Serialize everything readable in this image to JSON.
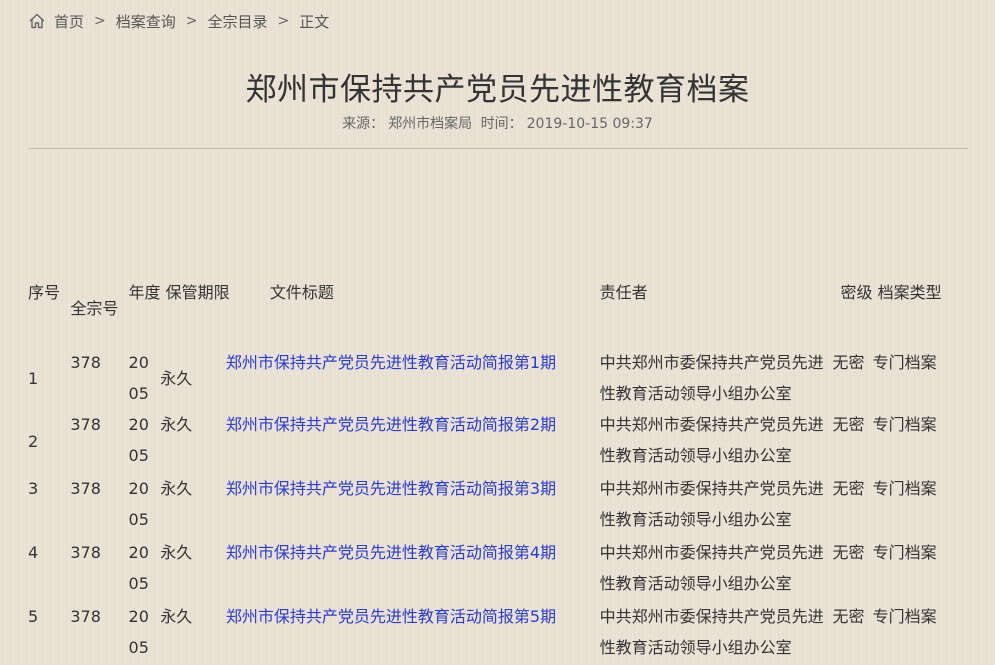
{
  "breadcrumb": {
    "home": "首页",
    "archive_query": "档案查询",
    "catalog": "全宗目录",
    "current": "正文",
    "separator": ">"
  },
  "article": {
    "title": "郑州市保持共产党员先进性教育档案",
    "source_label": "来源：",
    "source": "郑州市档案局",
    "time_label": "时间：",
    "time": "2019-10-15 09:37"
  },
  "table": {
    "headers": {
      "seq": "序号",
      "fonds": "全宗号",
      "year": "年度",
      "period": "保管期限",
      "title": "文件标题",
      "responsible": "责任者",
      "secret": "密级",
      "type": "档案类型"
    },
    "rows": [
      {
        "seq": "1",
        "fonds": "378",
        "year": "2005",
        "period": "永久",
        "title": "郑州市保持共产党员先进性教育活动简报第1期",
        "responsible": "中共郑州市委保持共产党员先进性教育活动领导小组办公室",
        "secret": "无密",
        "type": "专门档案"
      },
      {
        "seq": "2",
        "fonds": "378",
        "year": "2005",
        "period": "永久",
        "title": "郑州市保持共产党员先进性教育活动简报第2期",
        "responsible": "中共郑州市委保持共产党员先进性教育活动领导小组办公室",
        "secret": "无密",
        "type": "专门档案"
      },
      {
        "seq": "3",
        "fonds": "378",
        "year": "2005",
        "period": "永久",
        "title": "郑州市保持共产党员先进性教育活动简报第3期",
        "responsible": "中共郑州市委保持共产党员先进性教育活动领导小组办公室",
        "secret": "无密",
        "type": "专门档案"
      },
      {
        "seq": "4",
        "fonds": "378",
        "year": "2005",
        "period": "永久",
        "title": "郑州市保持共产党员先进性教育活动简报第4期",
        "responsible": "中共郑州市委保持共产党员先进性教育活动领导小组办公室",
        "secret": "无密",
        "type": "专门档案"
      },
      {
        "seq": "5",
        "fonds": "378",
        "year": "2005",
        "period": "永久",
        "title": "郑州市保持共产党员先进性教育活动简报第5期",
        "responsible": "中共郑州市委保持共产党员先进性教育活动领导小组办公室",
        "secret": "无密",
        "type": "专门档案"
      }
    ]
  },
  "colors": {
    "background": "#ece4d6",
    "link": "#2a3bd6",
    "divider": "#c9b89a",
    "text": "#333333"
  },
  "icons": {
    "home": "home-icon"
  }
}
